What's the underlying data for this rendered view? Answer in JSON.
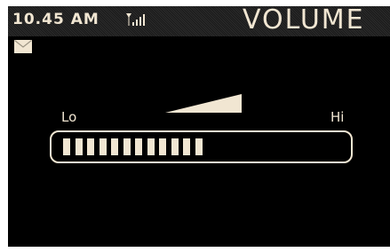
{
  "status_bar": {
    "time": "10.45 AM",
    "signal_icon": "signal-strength-icon",
    "title": "VOLUME"
  },
  "notifications": {
    "icon": "mail-icon"
  },
  "volume": {
    "lo_label": "Lo",
    "hi_label": "Hi",
    "level_steps": 12,
    "max_steps": 22,
    "level_fraction": 0.545
  },
  "colors": {
    "foreground": "#f1e6d2",
    "background": "#000000"
  }
}
